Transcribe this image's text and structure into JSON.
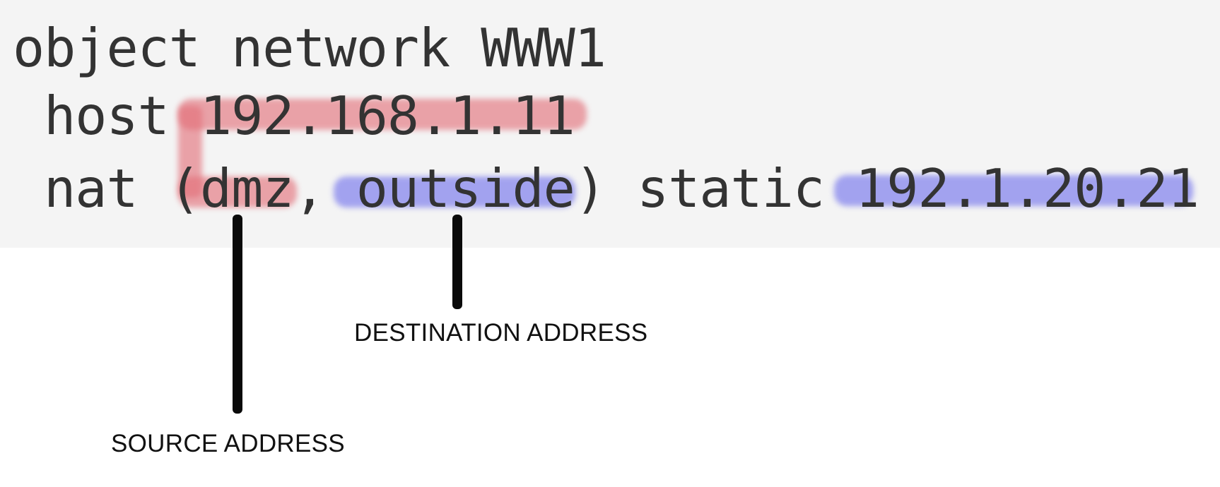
{
  "code": {
    "line1": "object network WWW1",
    "line2": " host 192.168.1.11",
    "line3": " nat (dmz, outside) static 192.1.20.21"
  },
  "annotations": {
    "source_label": "SOURCE ADDRESS",
    "destination_label": "DESTINATION ADDRESS"
  },
  "colors": {
    "code_background": "#f4f4f4",
    "source_highlight": "#e26e78",
    "destination_highlight": "#7070ec",
    "text": "#333333"
  }
}
